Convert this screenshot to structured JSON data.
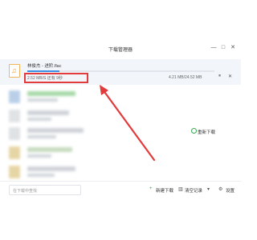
{
  "window": {
    "title": "下载管理器",
    "minimize_glyph": "—",
    "maximize_glyph": "□",
    "close_glyph": "✕"
  },
  "active_download": {
    "filename": "林俊杰 - 进阶.flac",
    "speed_text": "2.52 MB/S  还有 9秒",
    "size_text": "4.21 MB/24.52 MB",
    "progress_fraction": 0.17,
    "pause_glyph": "⏸",
    "close_glyph": "✕"
  },
  "failed_item": {
    "action_label": "重新下载"
  },
  "bottom": {
    "search_placeholder": "在下载中查找",
    "new_download_label": "新建下载",
    "clear_records_label": "清空记录",
    "settings_label": "设置"
  },
  "icons": {
    "music": "music-note-icon",
    "new": "plus-icon",
    "clear": "trash-icon",
    "settings": "gear-icon",
    "redownload": "refresh-icon"
  },
  "colors": {
    "accent": "#3a8ee6",
    "annotation": "#e23b3b",
    "success": "#35a853"
  }
}
